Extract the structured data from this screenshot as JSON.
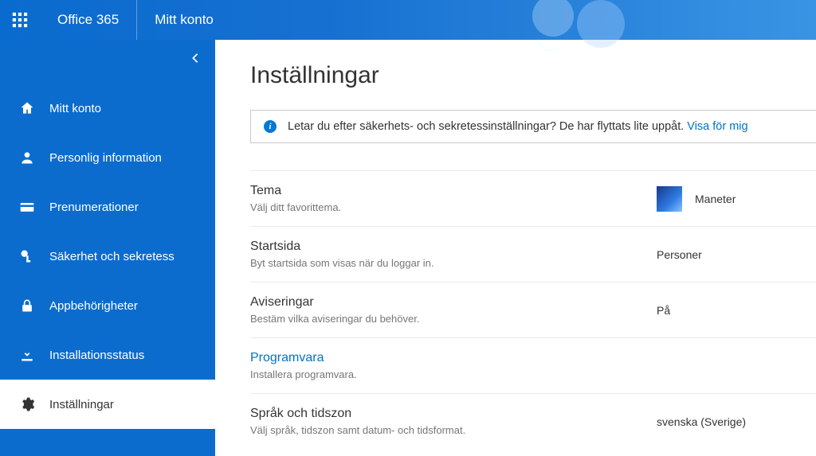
{
  "header": {
    "brand": "Office 365",
    "breadcrumb": "Mitt konto"
  },
  "sidebar": {
    "items": [
      {
        "id": "account",
        "label": "Mitt konto"
      },
      {
        "id": "personal",
        "label": "Personlig information"
      },
      {
        "id": "subs",
        "label": "Prenumerationer"
      },
      {
        "id": "security",
        "label": "Säkerhet och sekretess"
      },
      {
        "id": "perms",
        "label": "Appbehörigheter"
      },
      {
        "id": "install",
        "label": "Installationsstatus"
      },
      {
        "id": "settings",
        "label": "Inställningar"
      }
    ]
  },
  "page": {
    "title": "Inställningar",
    "banner_text": "Letar du efter säkerhets- och sekretessinställningar? De har flyttats lite uppåt.",
    "banner_link": "Visa för mig"
  },
  "settings": [
    {
      "title": "Tema",
      "sub": "Välj ditt favorittema.",
      "value": "Maneter",
      "thumb": true
    },
    {
      "title": "Startsida",
      "sub": "Byt startsida som visas när du loggar in.",
      "value": "Personer"
    },
    {
      "title": "Aviseringar",
      "sub": "Bestäm vilka aviseringar du behöver.",
      "value": "På"
    },
    {
      "title": "Programvara",
      "sub": "Installera programvara.",
      "value": "",
      "linklike": true
    },
    {
      "title": "Språk och tidszon",
      "sub": "Välj språk, tidszon samt datum- och tidsformat.",
      "value": "svenska (Sverige)"
    }
  ]
}
